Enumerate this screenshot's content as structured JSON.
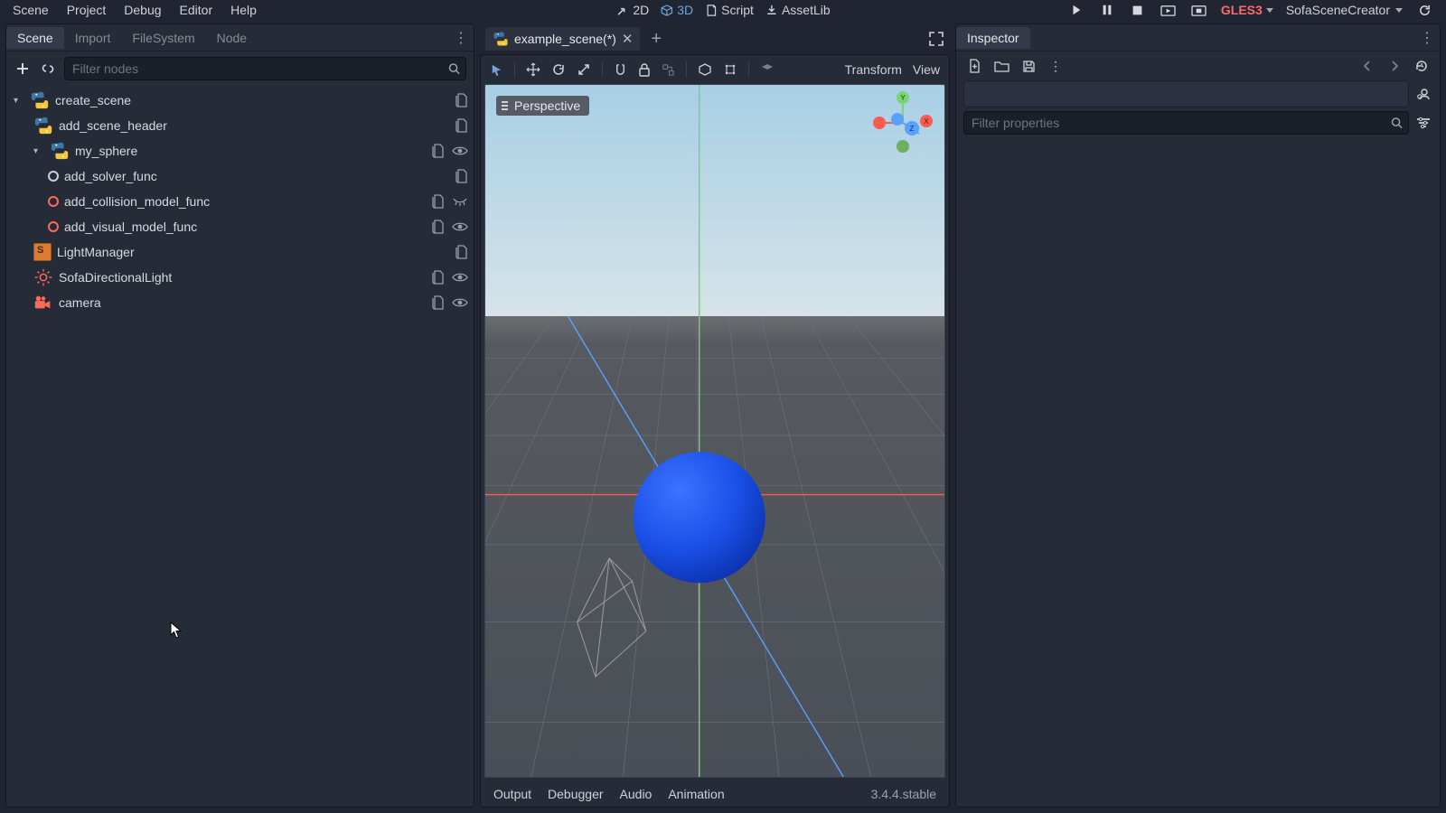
{
  "menubar": {
    "items": [
      "Scene",
      "Project",
      "Debug",
      "Editor",
      "Help"
    ]
  },
  "modes": {
    "m2d": "2D",
    "m3d": "3D",
    "script": "Script",
    "assetlib": "AssetLib"
  },
  "renderer": "GLES3",
  "workspace": "SofaSceneCreator",
  "left": {
    "tabs": [
      "Scene",
      "Import",
      "FileSystem",
      "Node"
    ],
    "filter_placeholder": "Filter nodes",
    "tree": [
      {
        "label": "create_scene"
      },
      {
        "label": "add_scene_header"
      },
      {
        "label": "my_sphere"
      },
      {
        "label": "add_solver_func"
      },
      {
        "label": "add_collision_model_func"
      },
      {
        "label": "add_visual_model_func"
      },
      {
        "label": "LightManager"
      },
      {
        "label": "SofaDirectionalLight"
      },
      {
        "label": "camera"
      }
    ]
  },
  "center": {
    "scene_tab_label": "example_scene(*)",
    "viewport_mode": "Perspective",
    "toolbar": {
      "transform": "Transform",
      "view": "View"
    },
    "bottom_tabs": [
      "Output",
      "Debugger",
      "Audio",
      "Animation"
    ],
    "version": "3.4.4.stable"
  },
  "inspector": {
    "title": "Inspector",
    "filter_placeholder": "Filter properties"
  },
  "axes": {
    "x": "X",
    "y": "Y",
    "z": "Z"
  }
}
